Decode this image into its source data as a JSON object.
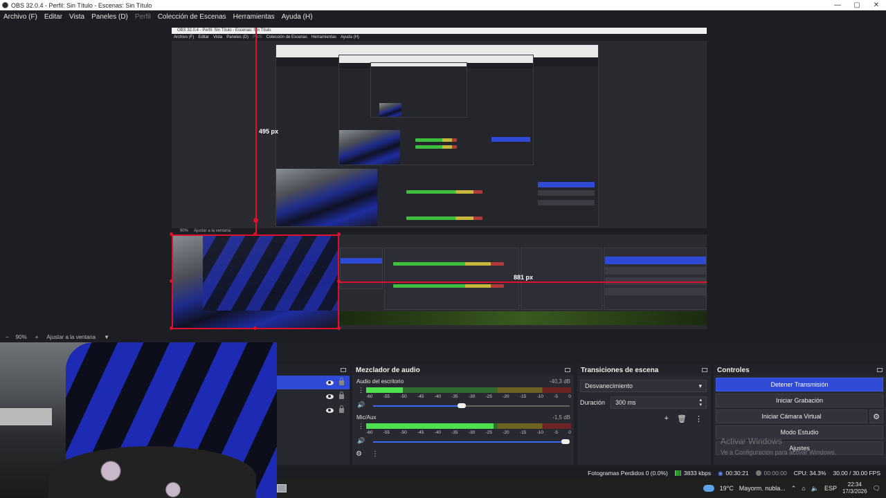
{
  "window": {
    "title": "OBS 32.0.4 - Perfil: Sin Título - Escenas: Sin Título",
    "minimize": "—",
    "maximize": "▢",
    "close": "✕"
  },
  "menu": {
    "items": [
      "Archivo (F)",
      "Editar",
      "Vista",
      "Paneles (D)",
      "Perfil",
      "Colección de Escenas",
      "Herramientas",
      "Ayuda (H)"
    ]
  },
  "preview": {
    "measure_vertical": "495 px",
    "measure_horizontal": "881 px",
    "nested_title": "OBS 32.0.4 - Perfil: Sin Título - Escenas: Sin Título",
    "nested_menu": [
      "Archivo (F)",
      "Editar",
      "Vista",
      "Paneles (D)",
      "Perfil",
      "Colección de Escenas",
      "Herramientas",
      "Ayuda (H)"
    ],
    "nested_zoom": "90%",
    "nested_fit": "Ajustar a la ventana"
  },
  "zoom": {
    "level": "90%",
    "plus": "+",
    "minus": "−",
    "fit": "Ajustar a la ventana",
    "arrow": "▼"
  },
  "audio_mixer": {
    "title": "Mezclador de audio",
    "tracks": [
      {
        "name": "Audio del escritorio",
        "db": "-40,3 dB",
        "level": 0.18,
        "volume": 0.45
      },
      {
        "name": "Mic/Aux",
        "db": "-1,5 dB",
        "level": 0.62,
        "volume": 0.98
      }
    ],
    "ticks": [
      "-60",
      "-55",
      "-50",
      "-45",
      "-40",
      "-35",
      "-30",
      "-25",
      "-20",
      "-15",
      "-10",
      "-5",
      "0"
    ]
  },
  "transitions": {
    "title": "Transiciones de escena",
    "selected": "Desvanecimiento",
    "duration_label": "Duración",
    "duration_value": "300 ms"
  },
  "controls": {
    "title": "Controles",
    "stop_stream": "Detener Transmisión",
    "start_record": "Iniciar Grabación",
    "start_vcam": "Iniciar Cámara Virtual",
    "studio_mode": "Modo Estudio",
    "settings": "Ajustes"
  },
  "activation": {
    "title": "Activar Windows",
    "subtitle": "Ve a Configuración para activar Windows."
  },
  "status": {
    "dropped_frames": "Fotogramas Perdidos 0 (0.0%)",
    "bitrate": "3833 kbps",
    "stream_time": "00:30:21",
    "rec_time": "00:00:00",
    "cpu": "CPU: 34.3%",
    "fps": "30.00 / 30.00 FPS"
  },
  "taskbar": {
    "weather_temp": "19°C",
    "weather_desc": "Mayorm. nubla...",
    "lang": "ESP",
    "time": "22:34",
    "date": "17/3/2026"
  },
  "colors": {
    "accent": "#2f4bd6",
    "selection_red": "#e0102a",
    "background": "#1d1e24"
  }
}
